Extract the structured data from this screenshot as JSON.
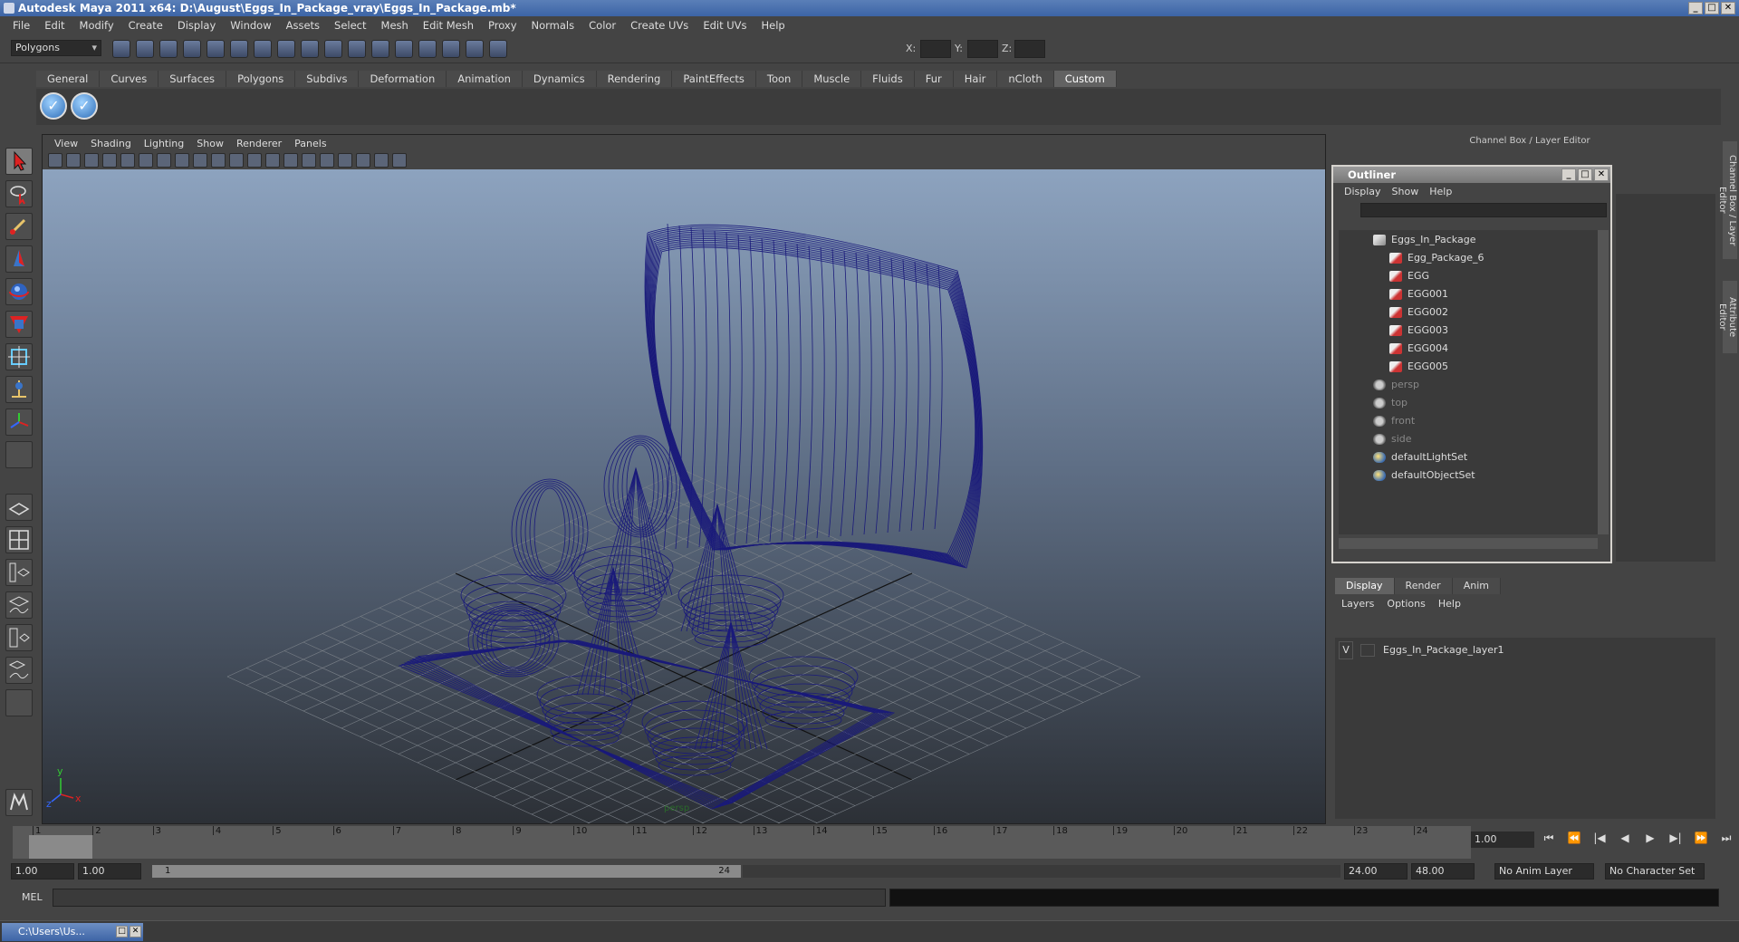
{
  "window": {
    "title": "Autodesk Maya 2011 x64: D:\\August\\Eggs_In_Package_vray\\Eggs_In_Package.mb*",
    "min": "_",
    "max": "□",
    "close": "✕"
  },
  "menubar": [
    "File",
    "Edit",
    "Modify",
    "Create",
    "Display",
    "Window",
    "Assets",
    "Select",
    "Mesh",
    "Edit Mesh",
    "Proxy",
    "Normals",
    "Color",
    "Create UVs",
    "Edit UVs",
    "Help"
  ],
  "toolbar": {
    "mode": "Polygons",
    "x_label": "X:",
    "y_label": "Y:",
    "z_label": "Z:"
  },
  "shelf": {
    "tabs": [
      "General",
      "Curves",
      "Surfaces",
      "Polygons",
      "Subdivs",
      "Deformation",
      "Animation",
      "Dynamics",
      "Rendering",
      "PaintEffects",
      "Toon",
      "Muscle",
      "Fluids",
      "Fur",
      "Hair",
      "nCloth",
      "Custom"
    ],
    "active_tab": "Custom",
    "button_glyph": "✓"
  },
  "viewport": {
    "menu": [
      "View",
      "Shading",
      "Lighting",
      "Show",
      "Renderer",
      "Panels"
    ],
    "camera_label": "persp",
    "axis_y": "y",
    "axis_x": "x",
    "axis_z": "z",
    "wire_color": "#1a1a7a"
  },
  "right_panel": {
    "header": "Channel Box / Layer Editor",
    "side_tabs": [
      "Channel Box / Layer Editor",
      "Attribute Editor"
    ]
  },
  "outliner": {
    "title": "Outliner",
    "menu": [
      "Display",
      "Show",
      "Help"
    ],
    "items": [
      {
        "label": "Eggs_In_Package",
        "icon": "group-icon",
        "dim": false
      },
      {
        "label": "Egg_Package_6",
        "icon": "mesh-icon",
        "dim": false
      },
      {
        "label": "EGG",
        "icon": "mesh-icon",
        "dim": false
      },
      {
        "label": "EGG001",
        "icon": "mesh-icon",
        "dim": false
      },
      {
        "label": "EGG002",
        "icon": "mesh-icon",
        "dim": false
      },
      {
        "label": "EGG003",
        "icon": "mesh-icon",
        "dim": false
      },
      {
        "label": "EGG004",
        "icon": "mesh-icon",
        "dim": false
      },
      {
        "label": "EGG005",
        "icon": "mesh-icon",
        "dim": false
      },
      {
        "label": "persp",
        "icon": "camera-icon",
        "dim": true
      },
      {
        "label": "top",
        "icon": "camera-icon",
        "dim": true
      },
      {
        "label": "front",
        "icon": "camera-icon",
        "dim": true
      },
      {
        "label": "side",
        "icon": "camera-icon",
        "dim": true
      },
      {
        "label": "defaultLightSet",
        "icon": "set-icon",
        "dim": false
      },
      {
        "label": "defaultObjectSet",
        "icon": "set-icon",
        "dim": false
      }
    ]
  },
  "layer_editor": {
    "tabs": [
      "Display",
      "Render",
      "Anim"
    ],
    "active_tab": "Display",
    "menu": [
      "Layers",
      "Options",
      "Help"
    ],
    "layer_visible": "V",
    "layer_name": "Eggs_In_Package_layer1"
  },
  "timeline": {
    "frames": [
      "1",
      "2",
      "3",
      "4",
      "5",
      "6",
      "7",
      "8",
      "9",
      "10",
      "11",
      "12",
      "13",
      "14",
      "15",
      "16",
      "17",
      "18",
      "19",
      "20",
      "21",
      "22",
      "23",
      "24"
    ],
    "current_frame": "1.00",
    "playback": [
      "⏮",
      "⏪",
      "|◀",
      "◀",
      "▶",
      "▶|",
      "⏩",
      "⏭"
    ]
  },
  "range": {
    "start": "1.00",
    "anim_start": "1.00",
    "range_start_label": "1",
    "range_end_label": "24",
    "end": "24.00",
    "anim_end": "48.00",
    "anim_layer": "No Anim Layer",
    "character_set": "No Character Set"
  },
  "command_line": {
    "label": "MEL"
  },
  "taskbar": {
    "item": "C:\\Users\\Us..."
  }
}
